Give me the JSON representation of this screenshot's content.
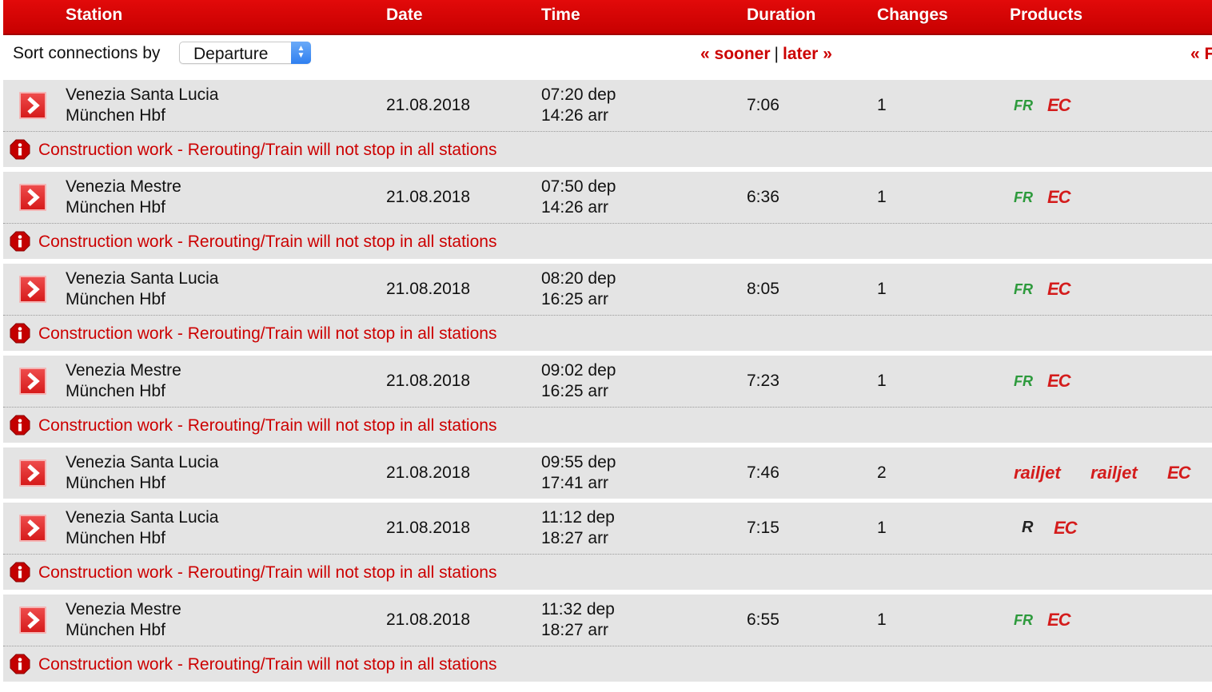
{
  "header": {
    "columns": [
      "Station",
      "Date",
      "Time",
      "Duration",
      "Changes",
      "Products"
    ]
  },
  "sort": {
    "label": "Sort connections by",
    "selected": "Departure",
    "sooner": "« sooner",
    "separator": "|",
    "later": "later »",
    "right_link": "« F"
  },
  "notice_text": "Construction work - Rerouting/Train will not stop in all stations",
  "connections": [
    {
      "from": "Venezia Santa Lucia",
      "to": "München Hbf",
      "date": "21.08.2018",
      "dep": "07:20 dep",
      "arr": "14:26 arr",
      "duration": "7:06",
      "changes": "1",
      "products": [
        "FR",
        "EC"
      ],
      "notice": true
    },
    {
      "from": "Venezia Mestre",
      "to": "München Hbf",
      "date": "21.08.2018",
      "dep": "07:50 dep",
      "arr": "14:26 arr",
      "duration": "6:36",
      "changes": "1",
      "products": [
        "FR",
        "EC"
      ],
      "notice": true
    },
    {
      "from": "Venezia Santa Lucia",
      "to": "München Hbf",
      "date": "21.08.2018",
      "dep": "08:20 dep",
      "arr": "16:25 arr",
      "duration": "8:05",
      "changes": "1",
      "products": [
        "FR",
        "EC"
      ],
      "notice": true
    },
    {
      "from": "Venezia Mestre",
      "to": "München Hbf",
      "date": "21.08.2018",
      "dep": "09:02 dep",
      "arr": "16:25 arr",
      "duration": "7:23",
      "changes": "1",
      "products": [
        "FR",
        "EC"
      ],
      "notice": true
    },
    {
      "from": "Venezia Santa Lucia",
      "to": "München Hbf",
      "date": "21.08.2018",
      "dep": "09:55 dep",
      "arr": "17:41 arr",
      "duration": "7:46",
      "changes": "2",
      "products": [
        "railjet",
        "railjet",
        "EC"
      ],
      "notice": false
    },
    {
      "from": "Venezia Santa Lucia",
      "to": "München Hbf",
      "date": "21.08.2018",
      "dep": "11:12 dep",
      "arr": "18:27 arr",
      "duration": "7:15",
      "changes": "1",
      "products": [
        "R",
        "EC"
      ],
      "notice": true
    },
    {
      "from": "Venezia Mestre",
      "to": "München Hbf",
      "date": "21.08.2018",
      "dep": "11:32 dep",
      "arr": "18:27 arr",
      "duration": "6:55",
      "changes": "1",
      "products": [
        "FR",
        "EC"
      ],
      "notice": true
    }
  ],
  "colors": {
    "header_red": "#d30000",
    "link_red": "#cc0000",
    "row_gray": "#e4e4e4",
    "fr_green": "#2d9a3c",
    "select_blue": "#2f7ff0"
  },
  "icons": {
    "details": "chevron-right-icon",
    "notice": "info-icon",
    "select": "updown-arrows-icon"
  }
}
